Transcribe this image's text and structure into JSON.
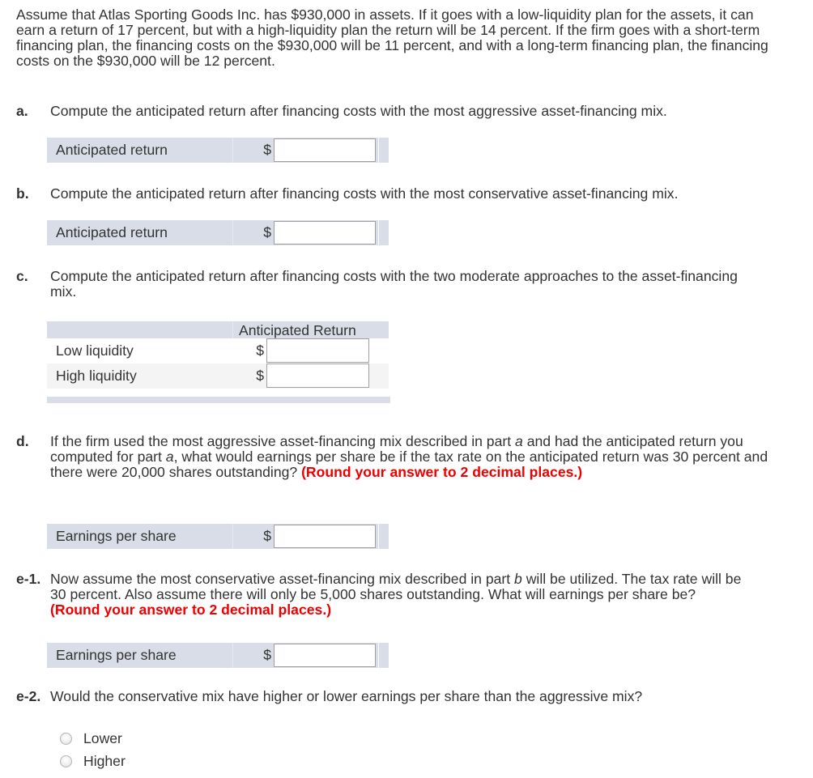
{
  "intro": "Assume that Atlas Sporting Goods Inc. has $930,000 in assets. If it goes with a low-liquidity plan for the assets, it can earn a return of 17 percent, but with a high-liquidity plan the return will be 14 percent. If the firm goes with a short-term financing plan, the financing costs on the $930,000 will be 11 percent, and with a long-term financing plan, the financing costs on the $930,000 will be 12 percent.",
  "colors": {
    "text": "#333333",
    "emphasis_red": "#ee0000",
    "table_header_bg": "#d9dde7",
    "alt_row_bg": "#f4f4f4"
  },
  "questions": {
    "a": {
      "label": "a.",
      "text": "Compute the anticipated return after financing costs with the most aggressive asset-financing mix.",
      "row_label": "Anticipated return",
      "currency": "$",
      "value": ""
    },
    "b": {
      "label": "b.",
      "text": "Compute the anticipated return after financing costs with the most conservative asset-financing mix.",
      "row_label": "Anticipated return",
      "currency": "$",
      "value": ""
    },
    "c": {
      "label": "c.",
      "text": "Compute the anticipated return after financing costs with the two moderate approaches to the asset-financing mix.",
      "column_header": "Anticipated Return",
      "rows": [
        {
          "label": "Low liquidity",
          "currency": "$",
          "value": ""
        },
        {
          "label": "High liquidity",
          "currency": "$",
          "value": ""
        }
      ]
    },
    "d": {
      "label": "d.",
      "text_1": "If the firm used the most aggressive asset-financing mix described in part ",
      "text_italic": "a",
      "text_2": " and had the anticipated return you computed for part ",
      "text_italic_2": "a",
      "text_3": ", what would earnings per share be if the tax rate on the anticipated return was 30 percent and there were 20,000 shares outstanding? ",
      "instruction": "(Round your answer to 2 decimal places.)",
      "row_label": "Earnings per share",
      "currency": "$",
      "value": ""
    },
    "e1": {
      "label": "e-1.",
      "text_1": "Now assume the most conservative asset-financing mix described in part ",
      "text_italic": "b",
      "text_2": " will be utilized. The tax rate will be 30 percent. Also assume there will only be 5,000 shares outstanding. What will earnings per share be? ",
      "instruction": "(Round your answer to 2 decimal places.)",
      "row_label": "Earnings per share",
      "currency": "$",
      "value": ""
    },
    "e2": {
      "label": "e-2.",
      "text": "Would the conservative mix have higher or lower earnings per share than the aggressive mix?",
      "options": [
        {
          "label": "Lower",
          "selected": false
        },
        {
          "label": "Higher",
          "selected": false
        }
      ]
    }
  }
}
